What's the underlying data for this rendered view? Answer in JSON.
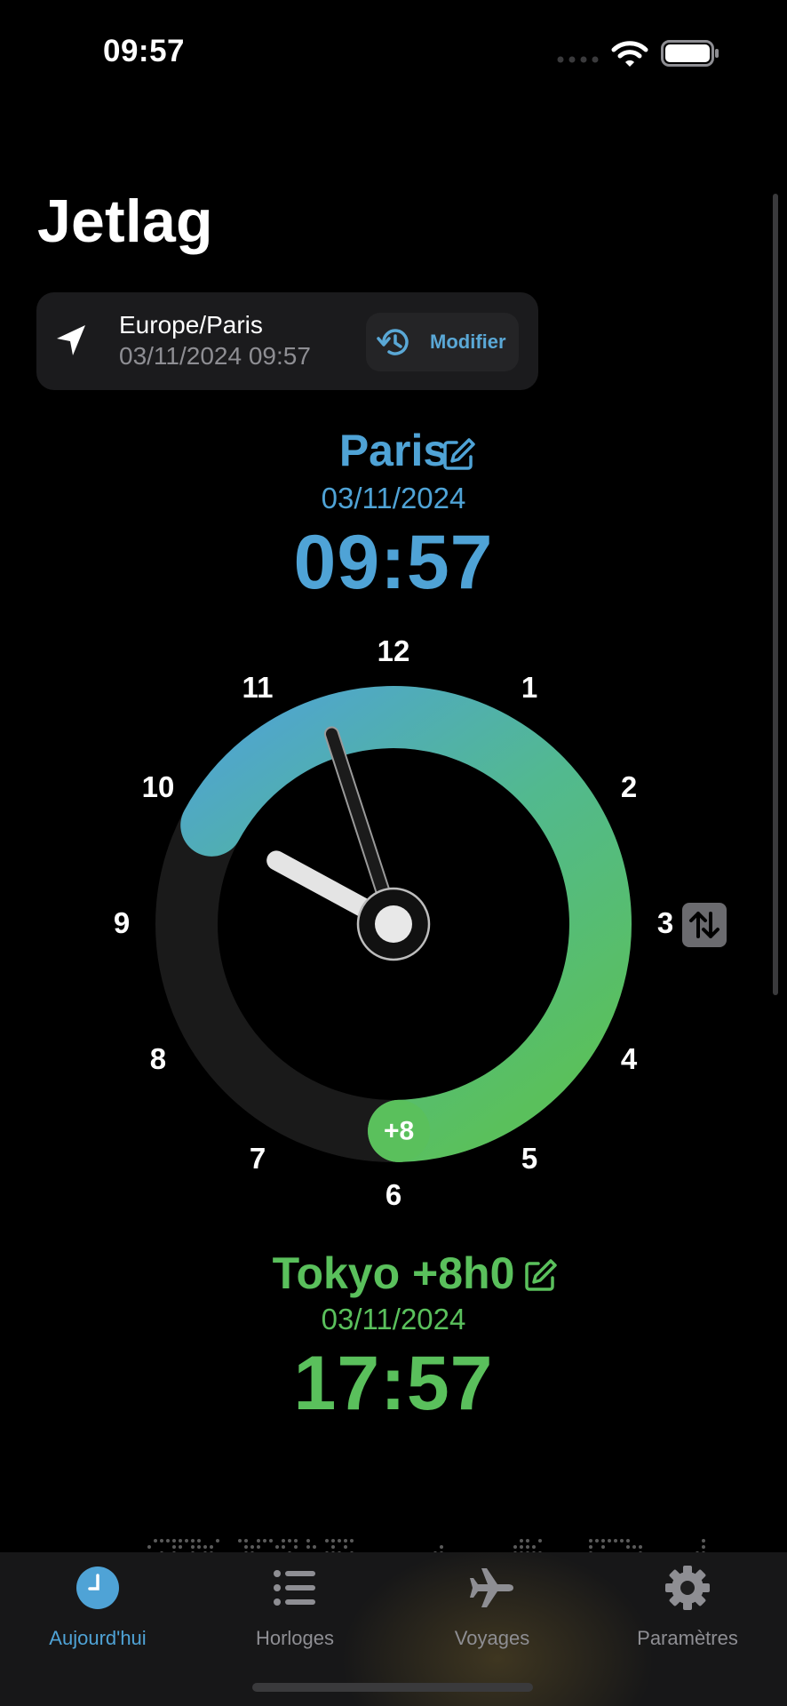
{
  "status_bar": {
    "time": "09:57"
  },
  "title": "Jetlag",
  "location_card": {
    "timezone": "Europe/Paris",
    "datetime": "03/11/2024 09:57",
    "modify_label": "Modifier"
  },
  "origin": {
    "name": "Paris",
    "date": "03/11/2024",
    "time": "09:57"
  },
  "clock": {
    "numbers": [
      "12",
      "1",
      "2",
      "3",
      "4",
      "5",
      "6",
      "7",
      "8",
      "9",
      "10",
      "11"
    ],
    "offset_badge": "+8",
    "origin_hour": 9.95,
    "destination_hour": 17.95,
    "colors": {
      "origin": "#4fa3d6",
      "destination": "#5ac05c",
      "track": "#1a1a1a"
    }
  },
  "destination": {
    "name": "Tokyo +8h0",
    "date": "03/11/2024",
    "time": "17:57"
  },
  "tabs": [
    {
      "label": "Aujourd'hui",
      "icon": "clock-icon",
      "active": true
    },
    {
      "label": "Horloges",
      "icon": "list-icon",
      "active": false
    },
    {
      "label": "Voyages",
      "icon": "airplane-icon",
      "active": false
    },
    {
      "label": "Paramètres",
      "icon": "gear-icon",
      "active": false
    }
  ]
}
